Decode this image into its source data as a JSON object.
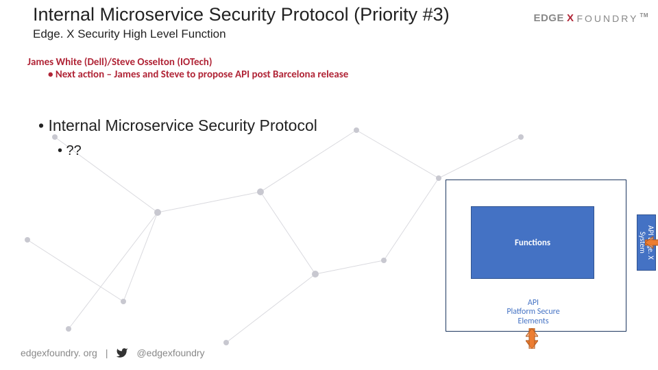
{
  "header": {
    "title": "Internal Microservice Security Protocol (Priority #3)",
    "subtitle": "Edge. X Security High Level Function"
  },
  "logo": {
    "part1": "EDGE",
    "part2": "X",
    "part3": "FOUNDRY",
    "tm": "TM"
  },
  "owners": {
    "line1": "James White (Dell)/Steve Osselton (IOTech)",
    "line2": "• Next action – James and Steve to propose API post Barcelona release"
  },
  "bullets": {
    "l1": "• Internal Microservice Security Protocol",
    "l2": "• ??"
  },
  "diagram": {
    "functions": "Functions",
    "api_platform_l1": "API",
    "api_platform_l2": "Platform Secure",
    "api_platform_l3": "Elements",
    "api_sys_l1": "API",
    "api_sys_l2": "Edge. X",
    "api_sys_l3": "System"
  },
  "footer": {
    "site": "edgexfoundry. org",
    "sep": "|",
    "handle": "@edgexfoundry"
  }
}
